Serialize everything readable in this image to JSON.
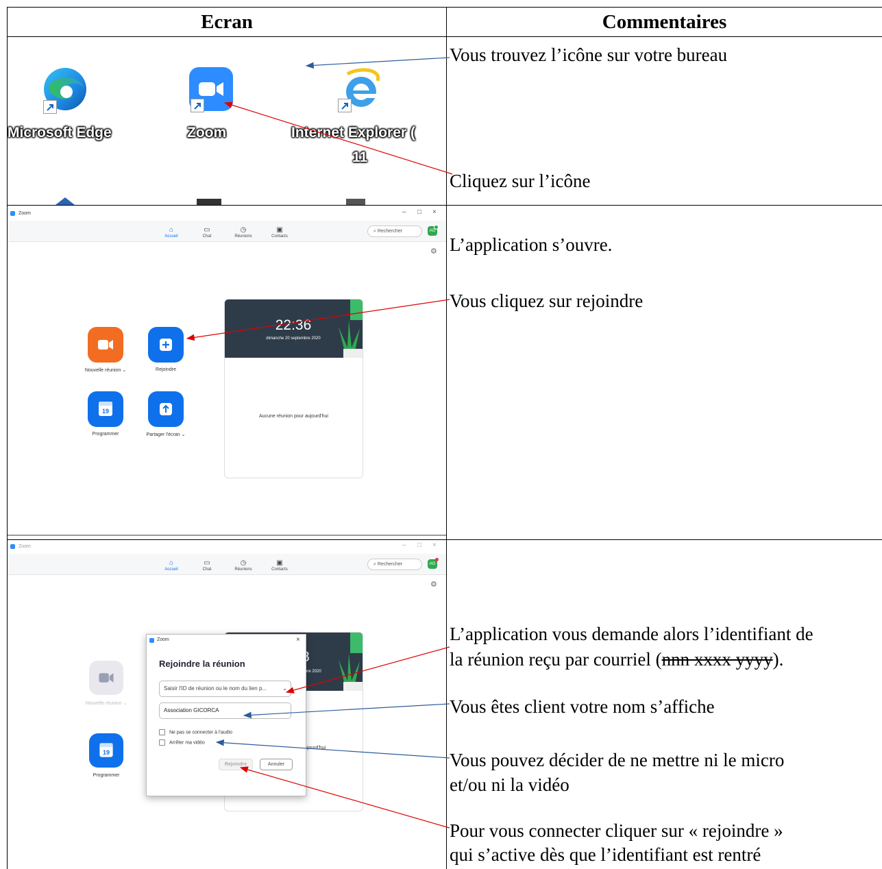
{
  "table": {
    "header_left": "Ecran",
    "header_right": "Commentaires"
  },
  "row1": {
    "desktop_icons": [
      {
        "label": "Microsoft Edge",
        "icon": "edge-icon"
      },
      {
        "label": "Zoom",
        "icon": "zoom-icon"
      },
      {
        "label": "Internet Explorer (",
        "label_line2": "11",
        "icon": "internet-explorer-icon"
      }
    ],
    "comments": [
      "Vous trouvez l’icône sur votre bureau",
      "Cliquez sur l’icône"
    ]
  },
  "row2": {
    "window_title": "Zoom",
    "window_controls": [
      "–",
      "□",
      "×"
    ],
    "nav": [
      "Accueil",
      "Chat",
      "Réunions",
      "Contacts"
    ],
    "search_placeholder": "Rechercher",
    "avatar": "AG",
    "actions": [
      {
        "label": "Nouvelle réunion",
        "icon": "video-camera-icon",
        "color": "#f26d21"
      },
      {
        "label": "Rejoindre",
        "icon": "plus-icon",
        "color": "#0e71eb"
      },
      {
        "label": "Programmer",
        "icon": "calendar-icon",
        "calendar_day": "19",
        "color": "#0e71eb"
      },
      {
        "label": "Partager l'écran",
        "icon": "share-up-arrow-icon",
        "color": "#0e71eb"
      }
    ],
    "clock_time": "22:36",
    "clock_date": "dimanche 20 septembre 2020",
    "no_meeting": "Aucune réunion pour aujourd'hui",
    "comments": [
      "L’application s’ouvre.",
      "Vous cliquez sur rejoindre"
    ]
  },
  "row3": {
    "window_title": "Zoom",
    "nav": [
      "Accueil",
      "Chat",
      "Réunions",
      "Contacts"
    ],
    "search_placeholder": "Rechercher",
    "avatar": "AG",
    "behind_labels": [
      "Nouvelle réunion",
      "Programmer"
    ],
    "calendar_day": "19",
    "card_fragment_time": "8",
    "card_fragment_date": "bre 2020",
    "card_fragment_text": "ujourd'hui",
    "dialog": {
      "title": "Zoom",
      "heading": "Rejoindre la réunion",
      "meeting_id_placeholder": "Saisir l'ID de réunion ou le nom du lien p...",
      "name_value": "Association GICORCA",
      "checkbox_audio": "Ne pas se connecter à l'audio",
      "checkbox_video": "Arrêter ma vidéo",
      "join_button": "Rejoindre",
      "cancel_button": "Annuler"
    },
    "comments": {
      "c1_line1": "L’application vous demande alors l’identifiant de",
      "c1_line2_prefix": "la réunion reçu par courriel (",
      "c1_struck": "nnn xxxx yyyy",
      "c1_suffix": ").",
      "c2": "Vous êtes client votre nom s’affiche",
      "c3_line1": "Vous pouvez décider de ne mettre ni le micro",
      "c3_line2": "et/ou ni la vidéo",
      "c4_line1": "Pour vous connecter cliquer sur « rejoindre »",
      "c4_line2": "qui s’active dès que l’identifiant est rentré"
    }
  },
  "colors": {
    "arrow_red": "#e00000",
    "arrow_blue": "#2e5c9a",
    "zoom_blue": "#0e71eb",
    "zoom_orange": "#f26d21"
  }
}
